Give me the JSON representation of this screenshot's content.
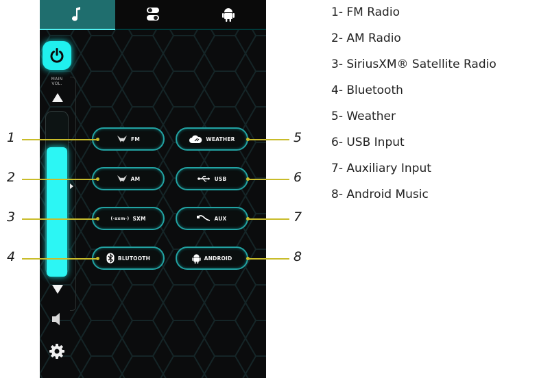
{
  "tabs": [
    {
      "name": "music",
      "icon": "music-note-icon",
      "active": true
    },
    {
      "name": "settings",
      "icon": "toggle-switches-icon",
      "active": false
    },
    {
      "name": "android",
      "icon": "android-icon",
      "active": false
    }
  ],
  "volume": {
    "label_line1": "MAIN",
    "label_line2": "VOL.",
    "level_fraction": 0.8
  },
  "sources": [
    {
      "label": "FM",
      "icon": "radio-wings-icon"
    },
    {
      "label": "AM",
      "icon": "radio-wings-icon"
    },
    {
      "label": "SXM",
      "icon_text": "(·sxm·)"
    },
    {
      "label": "BLUTOOTH",
      "icon": "bluetooth-icon"
    },
    {
      "label": "WEATHER",
      "icon": "cloud-icon"
    },
    {
      "label": "USB",
      "icon": "usb-icon"
    },
    {
      "label": "AUX",
      "icon": "aux-cable-icon"
    },
    {
      "label": "ANDROID",
      "icon": "android-icon"
    }
  ],
  "callouts": [
    "1",
    "2",
    "3",
    "4",
    "5",
    "6",
    "7",
    "8"
  ],
  "legend": [
    "1- FM Radio",
    "2- AM Radio",
    "3- SiriusXM® Satellite Radio",
    "4- Bluetooth",
    "5- Weather",
    "6- USB Input",
    "7- Auxiliary Input",
    "8- Android Music"
  ],
  "colors": {
    "accent": "#2cf6f4",
    "button_border": "#22a3a3",
    "callout_line": "#c9bc2a",
    "screen_bg": "#0b0c0d"
  }
}
